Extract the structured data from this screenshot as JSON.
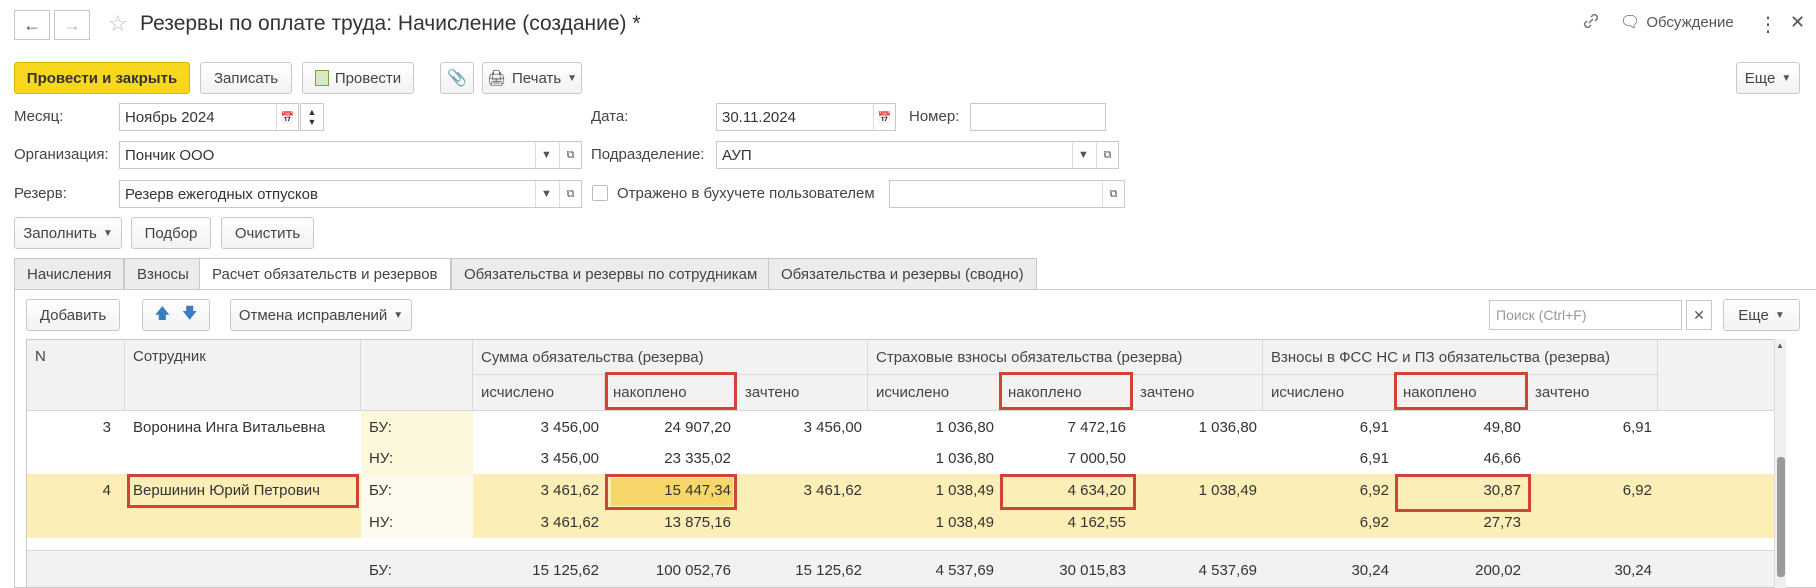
{
  "header": {
    "title": "Резервы по оплате труда: Начисление (создание) *",
    "discussion": "Обсуждение"
  },
  "toolbar": {
    "post_close": "Провести и закрыть",
    "save": "Записать",
    "post": "Провести",
    "print": "Печать",
    "more": "Еще"
  },
  "form": {
    "month_label": "Месяц:",
    "month_value": "Ноябрь 2024",
    "date_label": "Дата:",
    "date_value": "30.11.2024",
    "number_label": "Номер:",
    "number_value": "",
    "org_label": "Организация:",
    "org_value": "Пончик ООО",
    "dept_label": "Подразделение:",
    "dept_value": "АУП",
    "reserve_label": "Резерв:",
    "reserve_value": "Резерв ежегодных отпусков",
    "reflected_label": "Отражено в бухучете пользователем",
    "reflected_value": ""
  },
  "fill_bar": {
    "fill": "Заполнить",
    "pick": "Подбор",
    "clear": "Очистить"
  },
  "tabs": [
    {
      "label": "Начисления"
    },
    {
      "label": "Взносы"
    },
    {
      "label": "Расчет обязательств и резервов"
    },
    {
      "label": "Обязательства и резервы по сотрудникам"
    },
    {
      "label": "Обязательства и резервы (сводно)"
    }
  ],
  "tab_toolbar": {
    "add": "Добавить",
    "cancel_corrections": "Отмена исправлений",
    "search_placeholder": "Поиск (Ctrl+F)",
    "more": "Еще"
  },
  "table": {
    "col_n": "N",
    "col_employee": "Сотрудник",
    "group1": "Сумма обязательства (резерва)",
    "group2": "Страховые взносы обязательства (резерва)",
    "group3": "Взносы в ФСС НС и ПЗ обязательства (резерва)",
    "sub_calc": "исчислено",
    "sub_accum": "накоплено",
    "sub_offset": "зачтено",
    "rows": [
      {
        "n": "3",
        "employee": "Воронина Инга Витальевна",
        "type": "БУ:",
        "v": [
          "3 456,00",
          "24 907,20",
          "3 456,00",
          "1 036,80",
          "7 472,16",
          "1 036,80",
          "6,91",
          "49,80",
          "6,91"
        ]
      },
      {
        "n": "",
        "employee": "",
        "type": "НУ:",
        "v": [
          "3 456,00",
          "23 335,02",
          "",
          "1 036,80",
          "7 000,50",
          "",
          "6,91",
          "46,66",
          ""
        ]
      },
      {
        "n": "4",
        "employee": "Вершинин Юрий Петрович",
        "type": "БУ:",
        "v": [
          "3 461,62",
          "15 447,34",
          "3 461,62",
          "1 038,49",
          "4 634,20",
          "1 038,49",
          "6,92",
          "30,87",
          "6,92"
        ]
      },
      {
        "n": "",
        "employee": "",
        "type": "НУ:",
        "v": [
          "3 461,62",
          "13 875,16",
          "",
          "1 038,49",
          "4 162,55",
          "",
          "6,92",
          "27,73",
          ""
        ]
      }
    ],
    "total": {
      "type": "БУ:",
      "v": [
        "15 125,62",
        "100 052,76",
        "15 125,62",
        "4 537,69",
        "30 015,83",
        "4 537,69",
        "30,24",
        "200,02",
        "30,24"
      ]
    }
  },
  "colors": {
    "accent": "#f7d81f",
    "selected_row": "#fbeeb7",
    "highlight": "#d0433b"
  }
}
